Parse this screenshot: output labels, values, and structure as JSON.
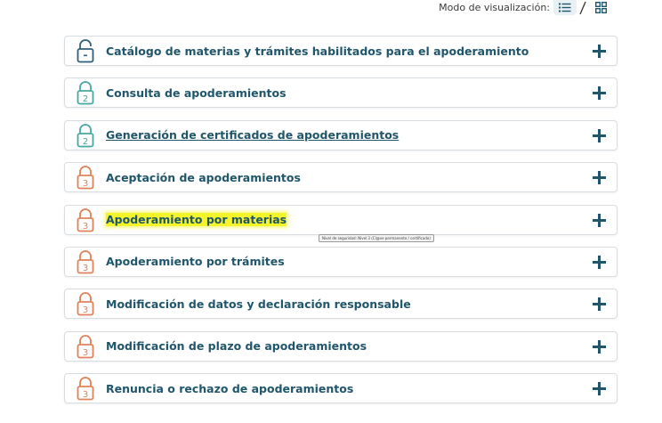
{
  "view_mode": {
    "label": "Modo de visualización:",
    "separator": "/",
    "options": [
      "list-icon",
      "grid-icon"
    ],
    "selected": "list-icon"
  },
  "items": [
    {
      "title": "Catálogo de materias y trámites habilitados para el apoderamiento",
      "level": "",
      "icon": "unlocked-padlock-icon",
      "style": "normal"
    },
    {
      "title": "Consulta de apoderamientos",
      "level": "2",
      "icon": "padlock-level-2-icon",
      "style": "normal"
    },
    {
      "title": "Generación de certificados de apoderamientos",
      "level": "2",
      "icon": "padlock-level-2-icon",
      "style": "link"
    },
    {
      "title": "Aceptación de apoderamientos",
      "level": "3",
      "icon": "padlock-level-3-icon",
      "style": "normal"
    },
    {
      "title": "Apoderamiento por materias",
      "level": "3",
      "icon": "padlock-level-3-icon",
      "style": "highlighted"
    },
    {
      "title": "Apoderamiento por trámites",
      "level": "3",
      "icon": "padlock-level-3-icon",
      "style": "normal"
    },
    {
      "title": "Modificación de datos y declaración responsable",
      "level": "3",
      "icon": "padlock-level-3-icon",
      "style": "normal"
    },
    {
      "title": "Modificación de plazo de apoderamientos",
      "level": "3",
      "icon": "padlock-level-3-icon",
      "style": "normal"
    },
    {
      "title": "Renuncia o rechazo de apoderamientos",
      "level": "3",
      "icon": "padlock-level-3-icon",
      "style": "normal"
    }
  ],
  "tooltip": "Nivel de seguridad: Nivel 3 (Cl@ve permanente / certificado)",
  "colors": {
    "title": "#20566b",
    "level2": "#4aa8a4",
    "level3": "#e0825a",
    "unlocked": "#2f5f7a",
    "highlight": "#f4f42a"
  }
}
